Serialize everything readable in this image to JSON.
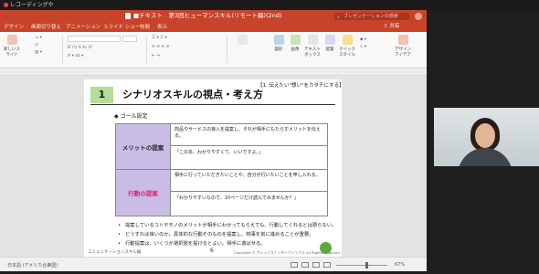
{
  "meeting": {
    "participant_label": "レコーディングや"
  },
  "titlebar": {
    "title": "■テキスト　第3回ヒューマンスキル(リモート編)(2nd)",
    "search_placeholder": "プレゼンテーションの検索",
    "accent": "#c7432a"
  },
  "ribbon": {
    "tabs": [
      "デザイン",
      "画面切り替え",
      "アニメーション",
      "スライド ショー",
      "校閲",
      "表示"
    ],
    "share_label": "共有",
    "groups": [
      "新しいスライド",
      "図形",
      "画像",
      "テキストボックス",
      "配置",
      "クイックスタイル",
      "デザインアイデア"
    ]
  },
  "slide": {
    "tagline": "【1. 伝えたい\"想い\"をカタチにする】",
    "number": "1",
    "heading": "シナリオスキルの視点・考え方",
    "goal_label": "◆ ゴール設定",
    "table": [
      {
        "label": "メリットの提案",
        "line1": "商品やサービスの導入を提案し、それが相手にもたらすメリットを伝える。",
        "line2": "「この本、わかりやすくて、いいですよ。」"
      },
      {
        "label": "行動の提案",
        "line1": "相手に行っていただきたいことや、自分が行いたいことを申し入れる。",
        "line2": "「わかりやすいなので、10ページだけ読んでみませんか？」"
      }
    ],
    "bullets": [
      "提案しているコトやモノのメリットが相手にわかってもらえても、行動してくれるとは限らない。",
      "どうすれば良いのか、具体的な行動そのものを提案し、物事を前に進めることが重要。",
      "行動提案は、いくつか選択肢を提けるとよい。相手に選ばせる。"
    ],
    "footer_left": "コミュニケーションスキル編",
    "page_number": "6",
    "copyright": "Copyright © アレックスインターナショナル All Rights Reserved."
  },
  "status": {
    "left": "日本語 (アメリカ合衆国)",
    "zoom": "67%"
  }
}
